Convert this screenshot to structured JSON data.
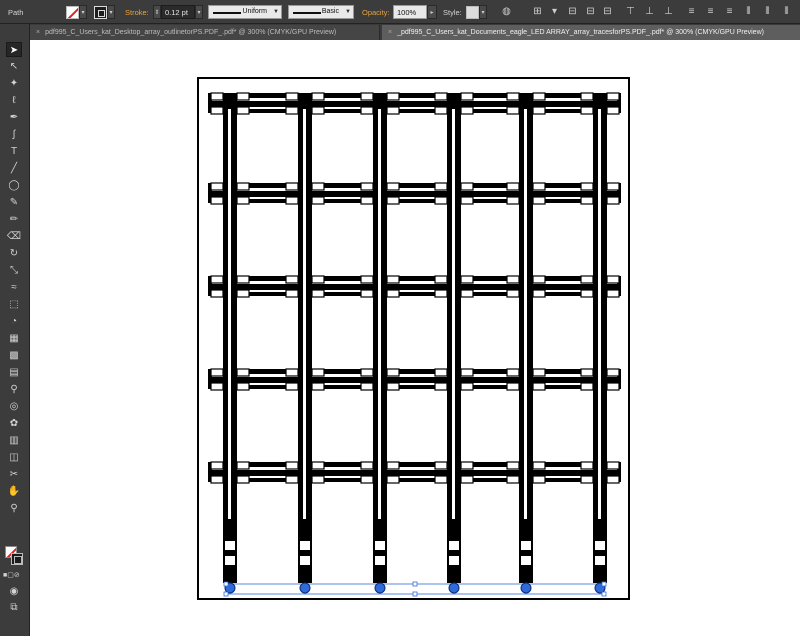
{
  "control_bar": {
    "selection_type": "Path",
    "stroke_label": "Stroke:",
    "stroke_weight": "0.12 pt",
    "profile_label": "Uniform",
    "brush_label": "Basic",
    "opacity_label": "Opacity:",
    "opacity_value": "100%",
    "style_label": "Style:"
  },
  "tabs": [
    {
      "label": "pdf995_C_Users_kat_Desktop_array_outlinetorPS.PDF_.pdf* @ 300% (CMYK/GPU Preview)",
      "active": false
    },
    {
      "label": "_pdf995_C_Users_kat_Documents_eagle_LED ARRAY_array_tracesforPS.PDF_.pdf* @ 300% (CMYK/GPU Preview)",
      "active": true
    }
  ],
  "tools": [
    "selection-tool",
    "direct-selection-tool",
    "magic-wand-tool",
    "lasso-tool",
    "pen-tool",
    "curvature-tool",
    "type-tool",
    "line-segment-tool",
    "ellipse-tool",
    "paintbrush-tool",
    "pencil-tool",
    "eraser-tool",
    "rotate-tool",
    "scale-tool",
    "width-tool",
    "free-transform-tool",
    "shape-builder-tool",
    "perspective-grid-tool",
    "mesh-tool",
    "gradient-tool",
    "eyedropper-tool",
    "blend-tool",
    "symbol-sprayer-tool",
    "column-graph-tool",
    "artboard-tool",
    "slice-tool",
    "hand-tool",
    "zoom-tool"
  ],
  "colors": {
    "fill": "none",
    "stroke": "#000000",
    "selection": "#2f6bd8"
  }
}
